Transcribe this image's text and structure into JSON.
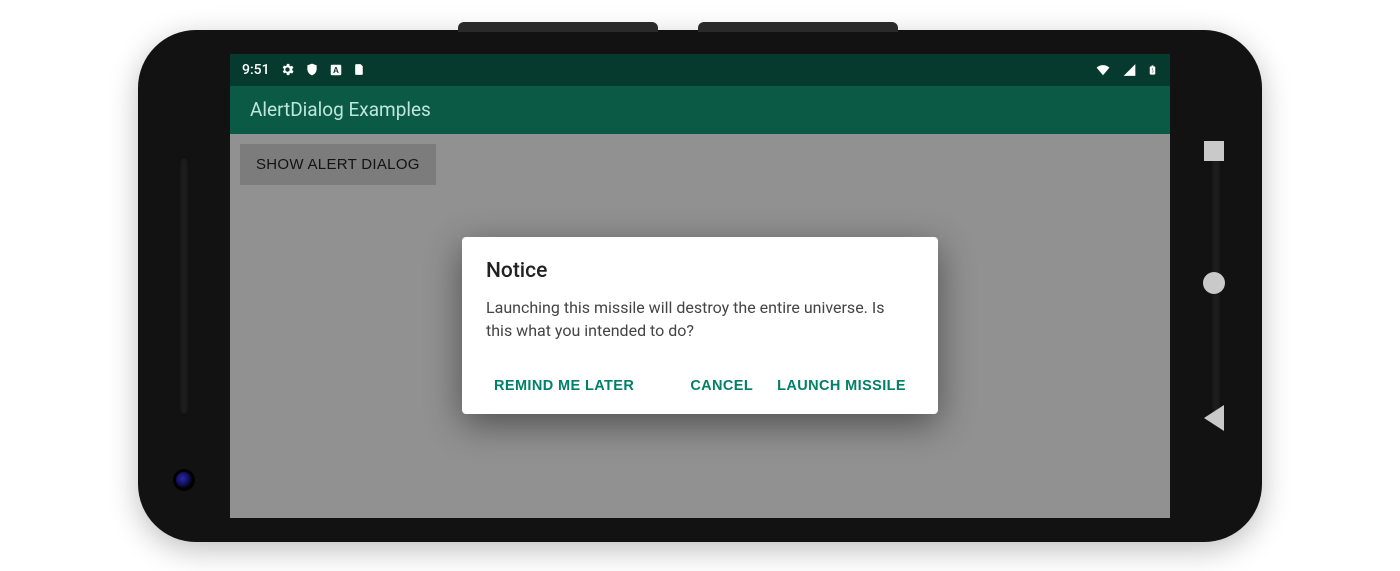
{
  "status_bar": {
    "time": "9:51",
    "icons_left": [
      "gear-icon",
      "shield-icon",
      "letter-a-icon",
      "sim-icon"
    ],
    "icons_right": [
      "wifi-icon",
      "signal-icon",
      "battery-icon"
    ]
  },
  "app_bar": {
    "title": "AlertDialog Examples"
  },
  "content": {
    "show_button_label": "SHOW ALERT DIALOG"
  },
  "dialog": {
    "title": "Notice",
    "message": "Launching this missile will destroy the entire universe. Is this what you intended to do?",
    "neutral_label": "REMIND ME LATER",
    "negative_label": "CANCEL",
    "positive_label": "LAUNCH MISSILE"
  },
  "nav": {
    "recent": "recent-apps",
    "home": "home",
    "back": "back"
  },
  "colors": {
    "status_bar_bg": "#063a2e",
    "app_bar_bg": "#0a5a46",
    "accent": "#008066"
  }
}
